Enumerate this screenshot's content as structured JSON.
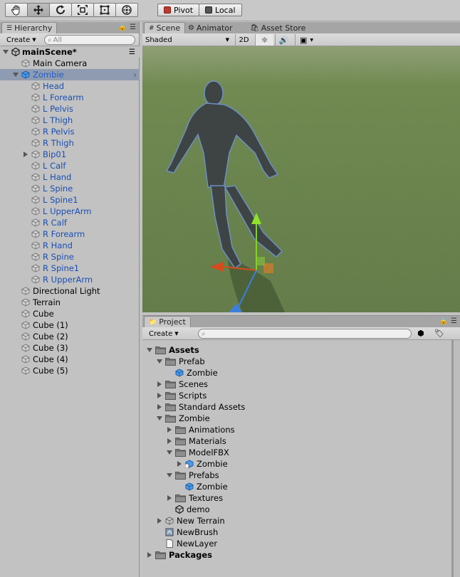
{
  "toolbar": {
    "tools": [
      "hand-tool",
      "move-tool",
      "rotate-tool",
      "scale-tool",
      "rect-tool",
      "transform-tool"
    ],
    "pivot_label": "Pivot",
    "local_label": "Local"
  },
  "hierarchy": {
    "tab_label": "Hierarchy",
    "create_label": "Create",
    "search_placeholder": "All",
    "scene_name": "mainScene*",
    "items": [
      {
        "label": "Main Camera",
        "indent": 1,
        "icon": "cube",
        "arrow": ""
      },
      {
        "label": "Zombie",
        "indent": 1,
        "icon": "cube-blue",
        "arrow": "down",
        "selected": true
      },
      {
        "label": "Head",
        "indent": 2,
        "icon": "cube",
        "arrow": "",
        "blue": true
      },
      {
        "label": "L Forearm",
        "indent": 2,
        "icon": "cube",
        "arrow": "",
        "blue": true
      },
      {
        "label": "L Pelvis",
        "indent": 2,
        "icon": "cube",
        "arrow": "",
        "blue": true
      },
      {
        "label": "L Thigh",
        "indent": 2,
        "icon": "cube",
        "arrow": "",
        "blue": true
      },
      {
        "label": "R Pelvis",
        "indent": 2,
        "icon": "cube",
        "arrow": "",
        "blue": true
      },
      {
        "label": "R Thigh",
        "indent": 2,
        "icon": "cube",
        "arrow": "",
        "blue": true
      },
      {
        "label": "Bip01",
        "indent": 2,
        "icon": "cube",
        "arrow": "right",
        "blue": true
      },
      {
        "label": "L Calf",
        "indent": 2,
        "icon": "cube",
        "arrow": "",
        "blue": true
      },
      {
        "label": "L Hand",
        "indent": 2,
        "icon": "cube",
        "arrow": "",
        "blue": true
      },
      {
        "label": "L Spine",
        "indent": 2,
        "icon": "cube",
        "arrow": "",
        "blue": true
      },
      {
        "label": "L Spine1",
        "indent": 2,
        "icon": "cube",
        "arrow": "",
        "blue": true
      },
      {
        "label": "L UpperArm",
        "indent": 2,
        "icon": "cube",
        "arrow": "",
        "blue": true
      },
      {
        "label": "R Calf",
        "indent": 2,
        "icon": "cube",
        "arrow": "",
        "blue": true
      },
      {
        "label": "R Forearm",
        "indent": 2,
        "icon": "cube",
        "arrow": "",
        "blue": true
      },
      {
        "label": "R Hand",
        "indent": 2,
        "icon": "cube",
        "arrow": "",
        "blue": true
      },
      {
        "label": "R Spine",
        "indent": 2,
        "icon": "cube",
        "arrow": "",
        "blue": true
      },
      {
        "label": "R Spine1",
        "indent": 2,
        "icon": "cube",
        "arrow": "",
        "blue": true
      },
      {
        "label": "R UpperArm",
        "indent": 2,
        "icon": "cube",
        "arrow": "",
        "blue": true
      },
      {
        "label": "Directional Light",
        "indent": 1,
        "icon": "cube",
        "arrow": ""
      },
      {
        "label": "Terrain",
        "indent": 1,
        "icon": "cube",
        "arrow": ""
      },
      {
        "label": "Cube",
        "indent": 1,
        "icon": "cube",
        "arrow": ""
      },
      {
        "label": "Cube (1)",
        "indent": 1,
        "icon": "cube",
        "arrow": ""
      },
      {
        "label": "Cube (2)",
        "indent": 1,
        "icon": "cube",
        "arrow": ""
      },
      {
        "label": "Cube (3)",
        "indent": 1,
        "icon": "cube",
        "arrow": ""
      },
      {
        "label": "Cube (4)",
        "indent": 1,
        "icon": "cube",
        "arrow": ""
      },
      {
        "label": "Cube (5)",
        "indent": 1,
        "icon": "cube",
        "arrow": ""
      }
    ]
  },
  "scene": {
    "tabs": [
      "Scene",
      "Animator",
      "Asset Store"
    ],
    "shading_mode": "Shaded",
    "mode_2d_label": "2D"
  },
  "project": {
    "tab_label": "Project",
    "create_label": "Create",
    "items": [
      {
        "label": "Assets",
        "indent": 0,
        "icon": "folder",
        "arrow": "down",
        "bold": true
      },
      {
        "label": "Prefab",
        "indent": 1,
        "icon": "folder",
        "arrow": "down"
      },
      {
        "label": "Zombie",
        "indent": 2,
        "icon": "cube-blue",
        "arrow": ""
      },
      {
        "label": "Scenes",
        "indent": 1,
        "icon": "folder",
        "arrow": "right"
      },
      {
        "label": "Scripts",
        "indent": 1,
        "icon": "folder",
        "arrow": "right"
      },
      {
        "label": "Standard Assets",
        "indent": 1,
        "icon": "folder",
        "arrow": "right"
      },
      {
        "label": "Zombie",
        "indent": 1,
        "icon": "folder",
        "arrow": "down"
      },
      {
        "label": "Animations",
        "indent": 2,
        "icon": "folder",
        "arrow": "right"
      },
      {
        "label": "Materials",
        "indent": 2,
        "icon": "folder",
        "arrow": "right"
      },
      {
        "label": "ModelFBX",
        "indent": 2,
        "icon": "folder",
        "arrow": "down"
      },
      {
        "label": "Zombie",
        "indent": 3,
        "icon": "model",
        "arrow": "right"
      },
      {
        "label": "Prefabs",
        "indent": 2,
        "icon": "folder",
        "arrow": "down"
      },
      {
        "label": "Zombie",
        "indent": 3,
        "icon": "cube-blue",
        "arrow": ""
      },
      {
        "label": "Textures",
        "indent": 2,
        "icon": "folder",
        "arrow": "right"
      },
      {
        "label": "demo",
        "indent": 2,
        "icon": "unity",
        "arrow": ""
      },
      {
        "label": "New Terrain",
        "indent": 1,
        "icon": "terrain",
        "arrow": "right"
      },
      {
        "label": "NewBrush",
        "indent": 1,
        "icon": "brush",
        "arrow": ""
      },
      {
        "label": "NewLayer",
        "indent": 1,
        "icon": "file",
        "arrow": ""
      },
      {
        "label": "Packages",
        "indent": 0,
        "icon": "folder",
        "arrow": "right",
        "bold": true
      }
    ]
  }
}
